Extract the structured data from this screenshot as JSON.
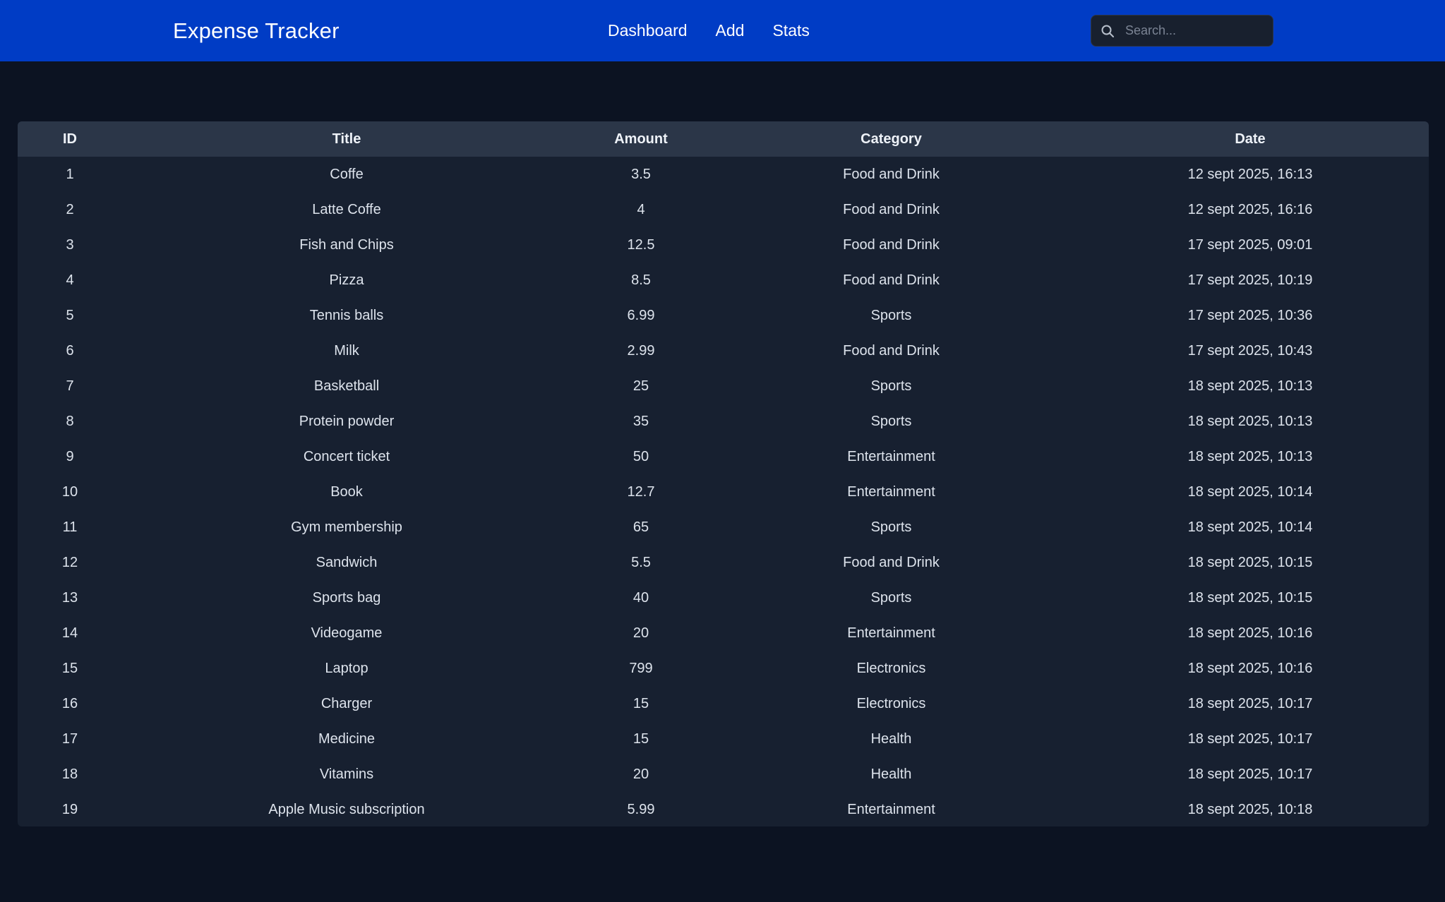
{
  "header": {
    "brand": "Expense Tracker",
    "nav": [
      {
        "label": "Dashboard"
      },
      {
        "label": "Add"
      },
      {
        "label": "Stats"
      }
    ],
    "search_placeholder": "Search..."
  },
  "colors": {
    "navbar": "#003cc5",
    "background": "#0c1322",
    "table_bg": "#172030",
    "table_header_bg": "#2b3648"
  },
  "icons": {
    "search": "search-icon"
  },
  "table": {
    "columns": [
      "ID",
      "Title",
      "Amount",
      "Category",
      "Date"
    ],
    "rows": [
      {
        "id": "1",
        "title": "Coffe",
        "amount": "3.5",
        "category": "Food and Drink",
        "date": "12 sept 2025, 16:13"
      },
      {
        "id": "2",
        "title": "Latte Coffe",
        "amount": "4",
        "category": "Food and Drink",
        "date": "12 sept 2025, 16:16"
      },
      {
        "id": "3",
        "title": "Fish and Chips",
        "amount": "12.5",
        "category": "Food and Drink",
        "date": "17 sept 2025, 09:01"
      },
      {
        "id": "4",
        "title": "Pizza",
        "amount": "8.5",
        "category": "Food and Drink",
        "date": "17 sept 2025, 10:19"
      },
      {
        "id": "5",
        "title": "Tennis balls",
        "amount": "6.99",
        "category": "Sports",
        "date": "17 sept 2025, 10:36"
      },
      {
        "id": "6",
        "title": "Milk",
        "amount": "2.99",
        "category": "Food and Drink",
        "date": "17 sept 2025, 10:43"
      },
      {
        "id": "7",
        "title": "Basketball",
        "amount": "25",
        "category": "Sports",
        "date": "18 sept 2025, 10:13"
      },
      {
        "id": "8",
        "title": "Protein powder",
        "amount": "35",
        "category": "Sports",
        "date": "18 sept 2025, 10:13"
      },
      {
        "id": "9",
        "title": "Concert ticket",
        "amount": "50",
        "category": "Entertainment",
        "date": "18 sept 2025, 10:13"
      },
      {
        "id": "10",
        "title": "Book",
        "amount": "12.7",
        "category": "Entertainment",
        "date": "18 sept 2025, 10:14"
      },
      {
        "id": "11",
        "title": "Gym membership",
        "amount": "65",
        "category": "Sports",
        "date": "18 sept 2025, 10:14"
      },
      {
        "id": "12",
        "title": "Sandwich",
        "amount": "5.5",
        "category": "Food and Drink",
        "date": "18 sept 2025, 10:15"
      },
      {
        "id": "13",
        "title": "Sports bag",
        "amount": "40",
        "category": "Sports",
        "date": "18 sept 2025, 10:15"
      },
      {
        "id": "14",
        "title": "Videogame",
        "amount": "20",
        "category": "Entertainment",
        "date": "18 sept 2025, 10:16"
      },
      {
        "id": "15",
        "title": "Laptop",
        "amount": "799",
        "category": "Electronics",
        "date": "18 sept 2025, 10:16"
      },
      {
        "id": "16",
        "title": "Charger",
        "amount": "15",
        "category": "Electronics",
        "date": "18 sept 2025, 10:17"
      },
      {
        "id": "17",
        "title": "Medicine",
        "amount": "15",
        "category": "Health",
        "date": "18 sept 2025, 10:17"
      },
      {
        "id": "18",
        "title": "Vitamins",
        "amount": "20",
        "category": "Health",
        "date": "18 sept 2025, 10:17"
      },
      {
        "id": "19",
        "title": "Apple Music subscription",
        "amount": "5.99",
        "category": "Entertainment",
        "date": "18 sept 2025, 10:18"
      }
    ]
  }
}
